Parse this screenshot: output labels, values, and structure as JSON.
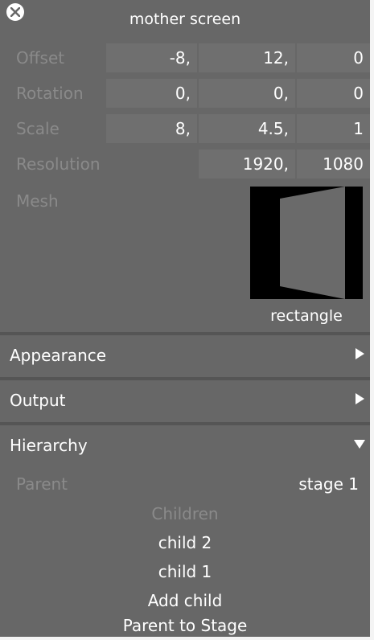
{
  "panel": {
    "title": "mother screen"
  },
  "transform": {
    "offset": {
      "label": "Offset",
      "x": "-8,",
      "y": "12,",
      "z": "0"
    },
    "rotation": {
      "label": "Rotation",
      "x": "0,",
      "y": "0,",
      "z": "0"
    },
    "scale": {
      "label": "Scale",
      "x": "8,",
      "y": "4.5,",
      "z": "1"
    },
    "resolution": {
      "label": "Resolution",
      "w": "1920,",
      "h": "1080"
    }
  },
  "mesh": {
    "label": "Mesh",
    "name": "rectangle"
  },
  "sections": {
    "appearance": {
      "label": "Appearance",
      "expanded": false
    },
    "output": {
      "label": "Output",
      "expanded": false
    },
    "hierarchy": {
      "label": "Hierarchy",
      "expanded": true
    }
  },
  "hierarchy": {
    "parent_label": "Parent",
    "parent_value": "stage 1",
    "children_heading": "Children",
    "children": [
      "child 2",
      "child 1"
    ],
    "add_child": "Add child",
    "parent_to_stage": "Parent to Stage"
  },
  "colors": {
    "panel_bg": "#676767",
    "field_bg": "#6f6f6f",
    "label_dim": "#8a8a8a",
    "text": "#ffffff"
  }
}
